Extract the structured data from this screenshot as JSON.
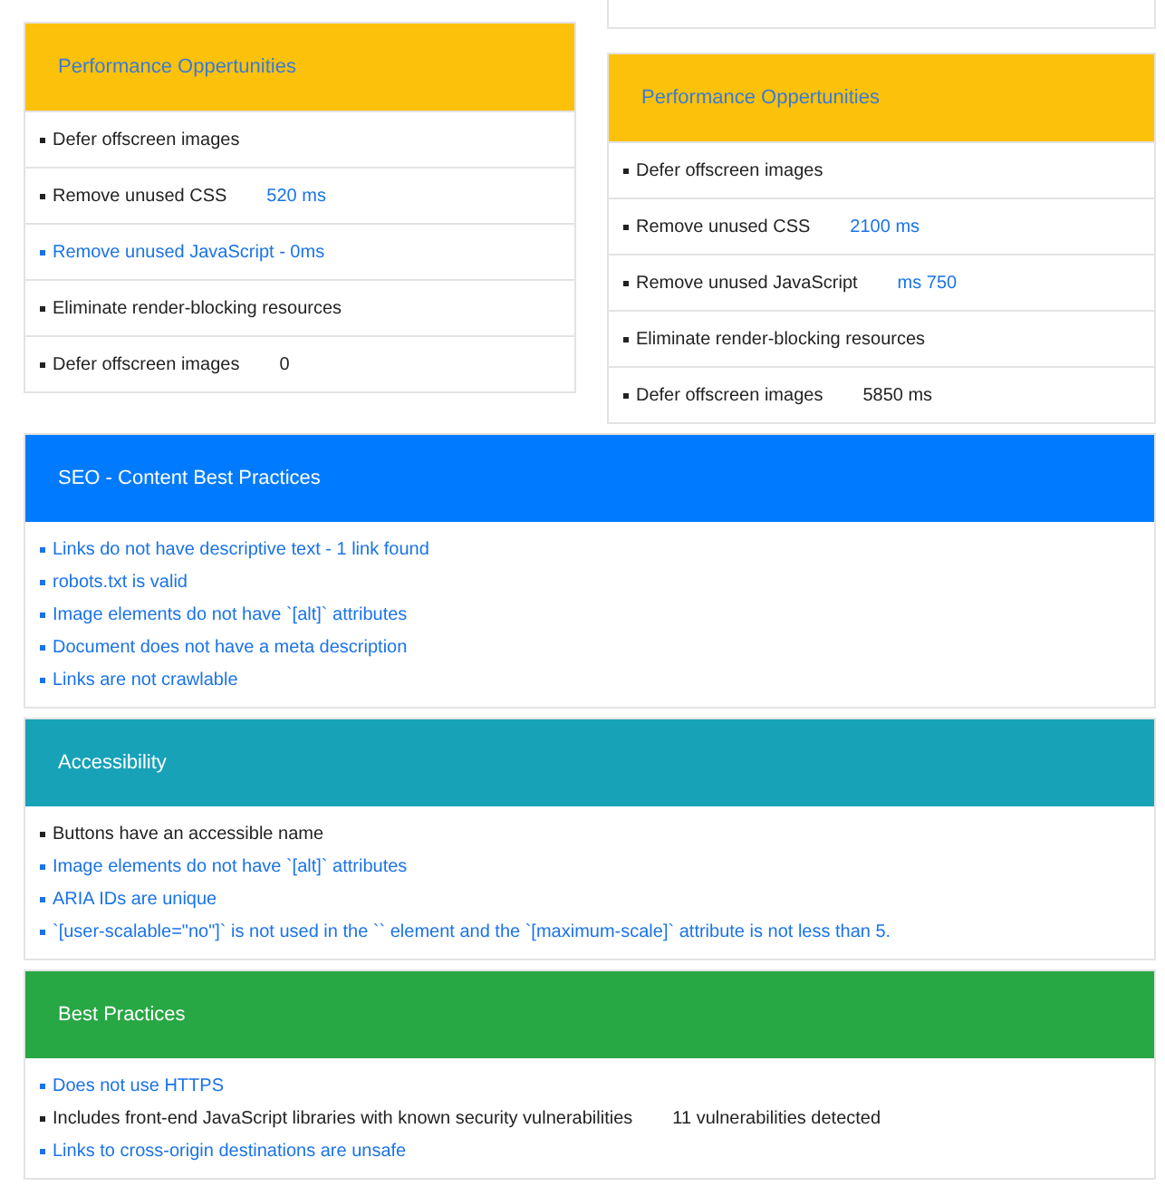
{
  "perf_columns": [
    {
      "title": "Performance Oppertunities",
      "items": [
        {
          "label": "Defer offscreen images",
          "kind": "text"
        },
        {
          "label": "Remove unused CSS",
          "kind": "text",
          "value": {
            "text": "520 ms",
            "kind": "link"
          }
        },
        {
          "label": "Remove unused JavaScript - 0ms",
          "kind": "link"
        },
        {
          "label": "Eliminate render-blocking resources",
          "kind": "text"
        },
        {
          "label": "Defer offscreen images",
          "kind": "text",
          "value": {
            "text": "0",
            "kind": "text"
          }
        }
      ]
    },
    {
      "title": "Performance Oppertunities",
      "items": [
        {
          "label": "Defer offscreen images",
          "kind": "text"
        },
        {
          "label": "Remove unused CSS",
          "kind": "text",
          "value": {
            "text": "2100 ms",
            "kind": "link"
          }
        },
        {
          "label": "Remove unused JavaScript",
          "kind": "text",
          "value": {
            "text": "ms 750",
            "kind": "link"
          }
        },
        {
          "label": "Eliminate render-blocking resources",
          "kind": "text"
        },
        {
          "label": "Defer offscreen images",
          "kind": "text",
          "value": {
            "text": "5850 ms",
            "kind": "text"
          }
        }
      ]
    }
  ],
  "sections": [
    {
      "title": "SEO - Content Best Practices",
      "color": "#007bff",
      "items": [
        {
          "label": "Links do not have descriptive text - 1 link found",
          "kind": "link"
        },
        {
          "label": "robots.txt is valid",
          "kind": "link"
        },
        {
          "label": "Image elements do not have `[alt]` attributes",
          "kind": "link"
        },
        {
          "label": "Document does not have a meta description",
          "kind": "link"
        },
        {
          "label": "Links are not crawlable",
          "kind": "link"
        }
      ]
    },
    {
      "title": "Accessibility",
      "color": "#17a2b8",
      "items": [
        {
          "label": "Buttons have an accessible name",
          "kind": "text"
        },
        {
          "label": "Image elements do not have `[alt]` attributes",
          "kind": "link"
        },
        {
          "label": "ARIA IDs are unique",
          "kind": "link"
        },
        {
          "label": "`[user-scalable=\"no\"]` is not used in the `` element and the `[maximum-scale]` attribute is not less than 5.",
          "kind": "link"
        }
      ]
    },
    {
      "title": "Best Practices",
      "color": "#28a745",
      "items": [
        {
          "label": "Does not use HTTPS",
          "kind": "link"
        },
        {
          "label": "Includes front-end JavaScript libraries with known security vulnerabilities",
          "kind": "text",
          "value": {
            "text": "11 vulnerabilities detected",
            "kind": "text"
          }
        },
        {
          "label": "Links to cross-origin destinations are unsafe",
          "kind": "link"
        }
      ]
    }
  ]
}
